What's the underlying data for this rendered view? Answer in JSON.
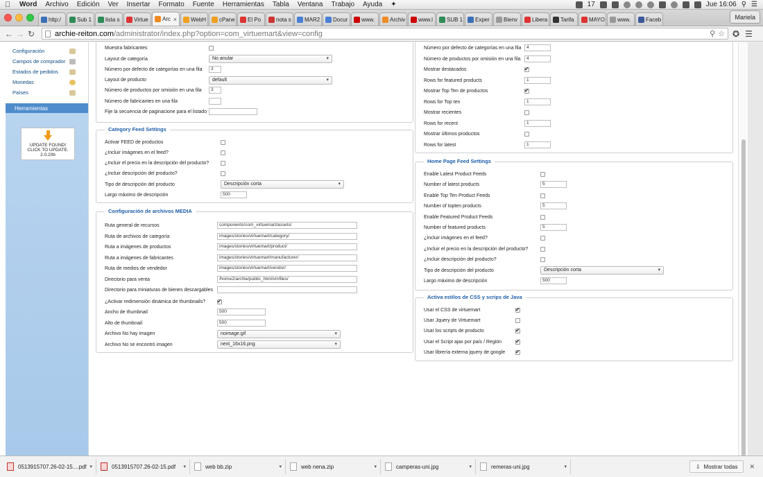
{
  "menubar": {
    "app": "Word",
    "items": [
      "Archivo",
      "Edición",
      "Ver",
      "Insertar",
      "Formato",
      "Fuente",
      "Herramientas",
      "Tabla",
      "Ventana",
      "Trabajo",
      "Ayuda"
    ],
    "status_num": "17",
    "clock": "Jue 16:06"
  },
  "tabs": [
    {
      "label": "http:/",
      "color": "#3b6fb6"
    },
    {
      "label": "Sub 1",
      "color": "#2e8b57"
    },
    {
      "label": "lista s",
      "color": "#2e8b57"
    },
    {
      "label": "Virtue",
      "color": "#d33"
    },
    {
      "label": "Arc",
      "color": "#f08a24",
      "active": true
    },
    {
      "label": "WebH",
      "color": "#f0a020"
    },
    {
      "label": "cPane",
      "color": "#f0a020"
    },
    {
      "label": "El Po",
      "color": "#d33"
    },
    {
      "label": "nota s",
      "color": "#c33"
    },
    {
      "label": "MAR2",
      "color": "#4a7fd4"
    },
    {
      "label": "Docur",
      "color": "#4a7fd4"
    },
    {
      "label": "www.",
      "color": "#c00"
    },
    {
      "label": "Archiv",
      "color": "#f08a24"
    },
    {
      "label": "www.l",
      "color": "#c00"
    },
    {
      "label": "SUB 1",
      "color": "#2e8b57"
    },
    {
      "label": "Exper",
      "color": "#3b6fb6"
    },
    {
      "label": "Bienv",
      "color": "#999"
    },
    {
      "label": "Libera",
      "color": "#d33"
    },
    {
      "label": "Tarifa",
      "color": "#333"
    },
    {
      "label": "MAYO",
      "color": "#d33"
    },
    {
      "label": "www.",
      "color": "#999"
    },
    {
      "label": "Faceb",
      "color": "#3b5998"
    }
  ],
  "profile": "Mariela",
  "url": {
    "host": "archie-reiton.com",
    "path": "/administrator/index.php?option=com_virtuemart&view=config"
  },
  "sidebar": {
    "items": [
      "Configuración",
      "Campos de comprador",
      "Estados de pedidos",
      "Monedas",
      "Países"
    ],
    "section": "Herramientas",
    "update": [
      "UPDATE FOUND!",
      "CLICK TO UPDATE.",
      "2.0.20b"
    ]
  },
  "left_top": {
    "muestra_fabricantes": "Muestra fabricantes",
    "layout_categoria": "Layout de categoría",
    "layout_categoria_val": "No anular",
    "num_cat_fila": "Número por defecto de categorías en una fila",
    "num_cat_fila_val": "3",
    "layout_producto": "Layout de producto",
    "layout_producto_val": "default",
    "num_prod_fila": "Número de productos por omisión en una fila",
    "num_prod_fila_val": "3",
    "num_fab_fila": "Número de fabricantes en una fila",
    "num_fab_fila_val": "",
    "paginacion": "Fije la secuencia de paginacione para el listado",
    "paginacion_val": ""
  },
  "category_feed": {
    "legend": "Category Feed Settings",
    "activar": "Activar FEED de productos",
    "imagenes": "¿Incluir imágenes en el feed?",
    "precio": "¿Incluir el precio en la descripción del producto?",
    "descripcion": "¿Incluir descripción del producto?",
    "tipo": "Tipo de descripción del producto",
    "tipo_val": "Descripción corta",
    "largo": "Largo máximo de descripción",
    "largo_val": "500"
  },
  "media": {
    "legend": "Configuración de archivos MEDIA",
    "rows": [
      {
        "label": "Ruta general de recursos",
        "value": "components/com_virtuemart/assets/"
      },
      {
        "label": "Ruta de archivos de categoría",
        "value": "images/stories/virtuemart/category/"
      },
      {
        "label": "Ruta a imágenes de productos",
        "value": "images/stories/virtuemart/product/"
      },
      {
        "label": "Ruta a imágenes de fabricantes",
        "value": "images/stories/virtuemart/manufacturer/"
      },
      {
        "label": "Ruta de medios de vendedor",
        "value": "images/stories/virtuemart/vendor/"
      },
      {
        "label": "Directorio para venta",
        "value": "/home2/archie/public_html/vmfiles/"
      },
      {
        "label": "Directorio para miniaturas de bienes descargables",
        "value": ""
      }
    ],
    "redimension": "¿Activar redimensión dinámica de thumbnails?",
    "ancho": "Ancho de thumbnail",
    "ancho_val": "500",
    "alto": "Alto de thumbnail",
    "alto_val": "500",
    "no_hay": "Archivo No hay imagen",
    "no_hay_val": "noimage.gif",
    "no_encontro": "Archivo No se encontró imagen",
    "no_encontro_val": "next_16x16.png"
  },
  "right_top": {
    "rows": [
      {
        "label": "Número por defecto de categorías en una fila",
        "type": "input",
        "value": "4"
      },
      {
        "label": "Número de productos por omisión en una fila",
        "type": "input",
        "value": "4"
      },
      {
        "label": "Mostrar destacados",
        "type": "check",
        "checked": true
      },
      {
        "label": "Rows for featured products",
        "type": "input",
        "value": "1"
      },
      {
        "label": "Mostrar Top Ten de productos",
        "type": "check",
        "checked": true
      },
      {
        "label": "Rows for Top ten",
        "type": "input",
        "value": "1"
      },
      {
        "label": "Mostrar recientes",
        "type": "check",
        "checked": false
      },
      {
        "label": "Rows for recent",
        "type": "input",
        "value": "1"
      },
      {
        "label": "Mostrar últimos productos",
        "type": "check",
        "checked": false
      },
      {
        "label": "Rows for latest",
        "type": "input",
        "value": "1"
      }
    ]
  },
  "home_feed": {
    "legend": "Home Page Feed Settings",
    "rows": [
      {
        "label": "Enable Latest Product Feeds",
        "type": "check",
        "checked": false
      },
      {
        "label": "Number of latest products",
        "type": "input",
        "value": "5"
      },
      {
        "label": "Enable Top Ten Product Feeds",
        "type": "check",
        "checked": false
      },
      {
        "label": "Number of topten products",
        "type": "input",
        "value": "5"
      },
      {
        "label": "Enable Featured Product Feeds",
        "type": "check",
        "checked": false
      },
      {
        "label": "Number of featured products",
        "type": "input",
        "value": "5"
      },
      {
        "label": "¿Incluir imágenes en el feed?",
        "type": "check",
        "checked": false
      },
      {
        "label": "¿Incluir el precio en la descripción del producto?",
        "type": "check",
        "checked": false
      },
      {
        "label": "¿Incluir descripción del producto?",
        "type": "check",
        "checked": false
      },
      {
        "label": "Tipo de descripción del producto",
        "type": "select",
        "value": "Descripción corta"
      },
      {
        "label": "Largo máximo de descripción",
        "type": "input",
        "value": "500"
      }
    ]
  },
  "css_js": {
    "legend": "Activa estilos de CSS y scrips de Java",
    "rows": [
      {
        "label": "Usar el CSS de virtuemart",
        "checked": true
      },
      {
        "label": "Usar Jquery de Virtuemart",
        "checked": false
      },
      {
        "label": "Usar los scripts de producto",
        "checked": true
      },
      {
        "label": "Usar el Script ajax por país / Región",
        "checked": true
      },
      {
        "label": "Usar librería externa jquery de google",
        "checked": true
      }
    ]
  },
  "downloads": {
    "items": [
      {
        "name": "0513915707.26-02-15....pdf",
        "type": "pdf"
      },
      {
        "name": "0513915707.26-02-15.pdf",
        "type": "pdf"
      },
      {
        "name": "web bb.zip",
        "type": "zip"
      },
      {
        "name": "web nena.zip",
        "type": "zip"
      },
      {
        "name": "camperas-uni.jpg",
        "type": "img"
      },
      {
        "name": "remeras-uni.jpg",
        "type": "img"
      }
    ],
    "show_all": "Mostrar todas"
  }
}
